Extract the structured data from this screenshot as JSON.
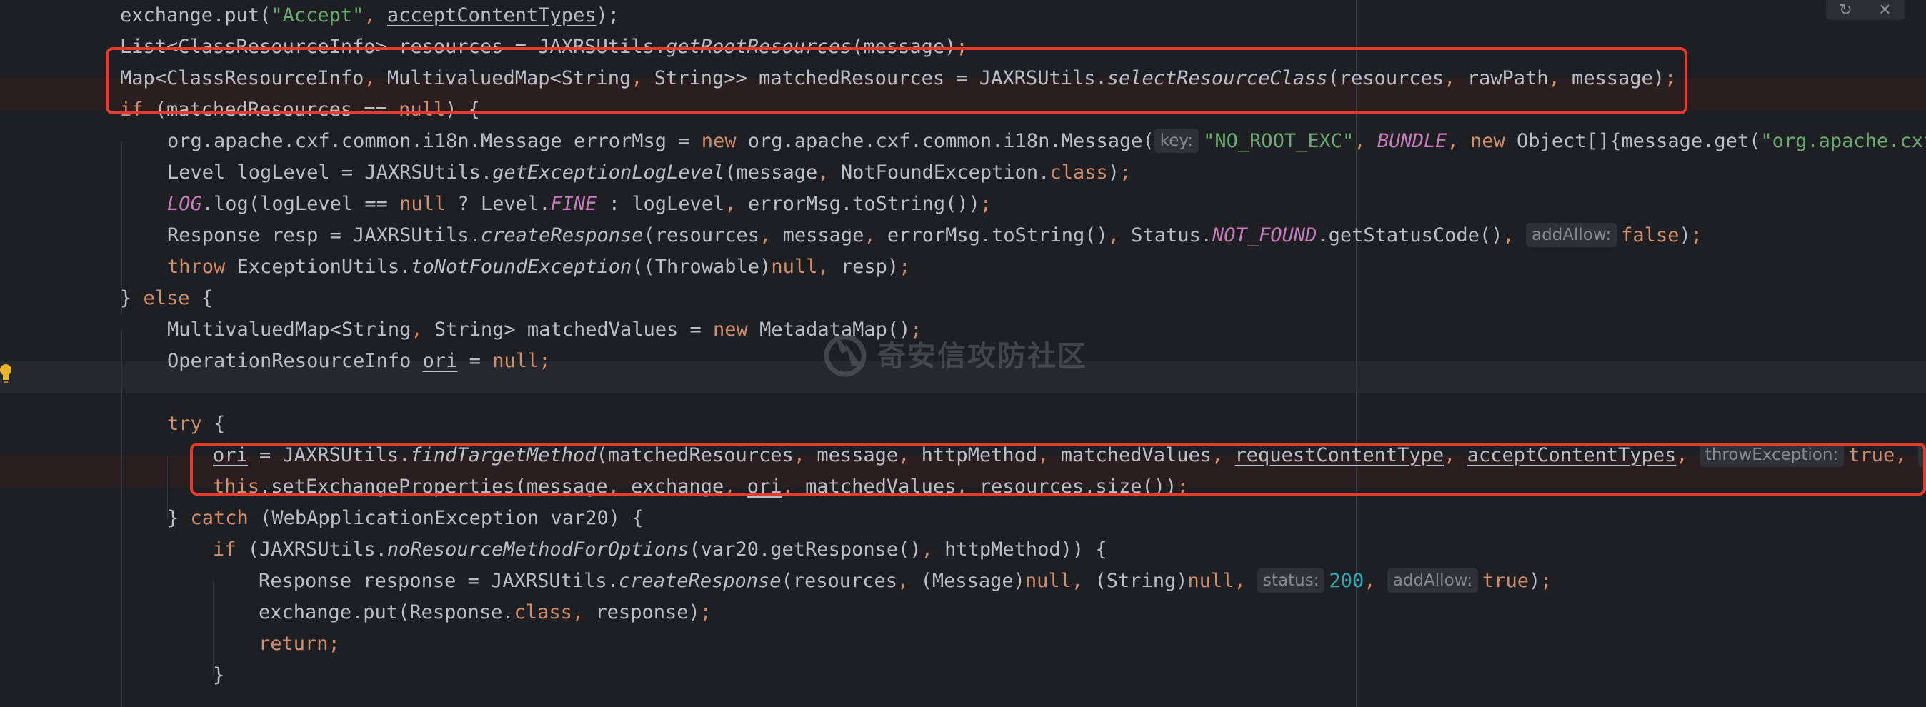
{
  "editor": {
    "watermark": "奇安信攻防社区",
    "toolbar": {
      "sync_icon": "↻",
      "close_icon": "✕"
    },
    "lines": [
      {
        "parts": [
          {
            "t": "exchange.put(",
            "c": ""
          },
          {
            "t": "\"Accept\"",
            "c": "tok-str"
          },
          {
            "t": ", ",
            "c": "tok-punc"
          },
          {
            "t": "acceptContentTypes",
            "c": "tok-ul"
          },
          {
            "t": ");",
            "c": ""
          }
        ]
      },
      {
        "parts": [
          {
            "t": "List<ClassResourceInfo> resources = JAXRSUtils.",
            "c": ""
          },
          {
            "t": "getRootResources",
            "c": "tok-it"
          },
          {
            "t": "(message)",
            "c": ""
          },
          {
            "t": ";",
            "c": "tok-punc"
          }
        ]
      },
      {
        "parts": [
          {
            "t": "Map<ClassResourceInfo",
            "c": ""
          },
          {
            "t": ", ",
            "c": "tok-punc"
          },
          {
            "t": "MultivaluedMap<String",
            "c": ""
          },
          {
            "t": ", ",
            "c": "tok-punc"
          },
          {
            "t": "String>> matchedResources = JAXRSUtils.",
            "c": ""
          },
          {
            "t": "selectResourceClass",
            "c": "tok-it"
          },
          {
            "t": "(resources",
            "c": ""
          },
          {
            "t": ", ",
            "c": "tok-punc"
          },
          {
            "t": "rawPath",
            "c": ""
          },
          {
            "t": ", ",
            "c": "tok-punc"
          },
          {
            "t": "message)",
            "c": ""
          },
          {
            "t": ";",
            "c": "tok-punc"
          }
        ]
      },
      {
        "parts": [
          {
            "t": "if ",
            "c": "tok-kw"
          },
          {
            "t": "(matchedResources == ",
            "c": ""
          },
          {
            "t": "null",
            "c": "tok-kw"
          },
          {
            "t": ") {",
            "c": ""
          }
        ]
      },
      {
        "parts": [
          {
            "t": "org.apache.cxf.common.i18n.Message errorMsg = ",
            "c": ""
          },
          {
            "t": "new ",
            "c": "tok-kw"
          },
          {
            "t": "org.apache.cxf.common.i18n.Message(",
            "c": ""
          },
          {
            "t": "key:",
            "c": "hint"
          },
          {
            "t": "\"NO_ROOT_EXC\"",
            "c": "tok-str"
          },
          {
            "t": ", ",
            "c": "tok-punc"
          },
          {
            "t": "BUNDLE",
            "c": "tok-static"
          },
          {
            "t": ", ",
            "c": "tok-punc"
          },
          {
            "t": "new ",
            "c": "tok-kw"
          },
          {
            "t": "Object[]{message.get(",
            "c": ""
          },
          {
            "t": "\"org.apache.cxf.",
            "c": "tok-str"
          }
        ]
      },
      {
        "parts": [
          {
            "t": "Level logLevel = JAXRSUtils.",
            "c": ""
          },
          {
            "t": "getExceptionLogLevel",
            "c": "tok-it"
          },
          {
            "t": "(message",
            "c": ""
          },
          {
            "t": ", ",
            "c": "tok-punc"
          },
          {
            "t": "NotFoundException.",
            "c": ""
          },
          {
            "t": "class",
            "c": "tok-kw"
          },
          {
            "t": ")",
            "c": ""
          },
          {
            "t": ";",
            "c": "tok-punc"
          }
        ]
      },
      {
        "parts": [
          {
            "t": "LOG",
            "c": "tok-static"
          },
          {
            "t": ".log(logLevel == ",
            "c": ""
          },
          {
            "t": "null ",
            "c": "tok-kw"
          },
          {
            "t": "? Level.",
            "c": ""
          },
          {
            "t": "FINE ",
            "c": "tok-static"
          },
          {
            "t": ": logLevel",
            "c": ""
          },
          {
            "t": ", ",
            "c": "tok-punc"
          },
          {
            "t": "errorMsg.toString())",
            "c": ""
          },
          {
            "t": ";",
            "c": "tok-punc"
          }
        ]
      },
      {
        "parts": [
          {
            "t": "Response resp = JAXRSUtils.",
            "c": ""
          },
          {
            "t": "createResponse",
            "c": "tok-it"
          },
          {
            "t": "(resources",
            "c": ""
          },
          {
            "t": ", ",
            "c": "tok-punc"
          },
          {
            "t": "message",
            "c": ""
          },
          {
            "t": ", ",
            "c": "tok-punc"
          },
          {
            "t": "errorMsg.toString()",
            "c": ""
          },
          {
            "t": ", ",
            "c": "tok-punc"
          },
          {
            "t": "Status.",
            "c": ""
          },
          {
            "t": "NOT_FOUND",
            "c": "tok-static"
          },
          {
            "t": ".getStatusCode()",
            "c": ""
          },
          {
            "t": ", ",
            "c": "tok-punc"
          },
          {
            "t": "addAllow:",
            "c": "hint"
          },
          {
            "t": "false",
            "c": "tok-kw"
          },
          {
            "t": ")",
            "c": ""
          },
          {
            "t": ";",
            "c": "tok-punc"
          }
        ]
      },
      {
        "parts": [
          {
            "t": "throw ",
            "c": "tok-kw"
          },
          {
            "t": "ExceptionUtils.",
            "c": ""
          },
          {
            "t": "toNotFoundException",
            "c": "tok-it"
          },
          {
            "t": "((Throwable)",
            "c": ""
          },
          {
            "t": "null",
            "c": "tok-kw"
          },
          {
            "t": ", ",
            "c": "tok-punc"
          },
          {
            "t": "resp)",
            "c": ""
          },
          {
            "t": ";",
            "c": "tok-punc"
          }
        ]
      },
      {
        "parts": [
          {
            "t": "} ",
            "c": ""
          },
          {
            "t": "else ",
            "c": "tok-kw"
          },
          {
            "t": "{",
            "c": ""
          }
        ]
      },
      {
        "parts": [
          {
            "t": "MultivaluedMap<String",
            "c": ""
          },
          {
            "t": ", ",
            "c": "tok-punc"
          },
          {
            "t": "String> matchedValues = ",
            "c": ""
          },
          {
            "t": "new ",
            "c": "tok-kw"
          },
          {
            "t": "MetadataMap()",
            "c": ""
          },
          {
            "t": ";",
            "c": "tok-punc"
          }
        ]
      },
      {
        "parts": [
          {
            "t": "OperationResourceInfo ",
            "c": ""
          },
          {
            "t": "ori",
            "c": "tok-ul"
          },
          {
            "t": " = ",
            "c": ""
          },
          {
            "t": "null",
            "c": "tok-kw"
          },
          {
            "t": ";",
            "c": "tok-punc"
          }
        ]
      },
      {
        "parts": []
      },
      {
        "parts": [
          {
            "t": "try ",
            "c": "tok-kw"
          },
          {
            "t": "{",
            "c": ""
          }
        ]
      },
      {
        "parts": [
          {
            "t": "ori",
            "c": "tok-ul"
          },
          {
            "t": " = JAXRSUtils.",
            "c": ""
          },
          {
            "t": "findTargetMethod",
            "c": "tok-it"
          },
          {
            "t": "(matchedResources",
            "c": ""
          },
          {
            "t": ", ",
            "c": "tok-punc"
          },
          {
            "t": "message",
            "c": ""
          },
          {
            "t": ", ",
            "c": "tok-punc"
          },
          {
            "t": "httpMethod",
            "c": ""
          },
          {
            "t": ", ",
            "c": "tok-punc"
          },
          {
            "t": "matchedValues",
            "c": ""
          },
          {
            "t": ", ",
            "c": "tok-punc"
          },
          {
            "t": "requestContentType",
            "c": "tok-ul"
          },
          {
            "t": ", ",
            "c": "tok-punc"
          },
          {
            "t": "acceptContentTypes",
            "c": "tok-ul"
          },
          {
            "t": ", ",
            "c": "tok-punc"
          },
          {
            "t": "throwException:",
            "c": "hint"
          },
          {
            "t": "true",
            "c": "tok-kw"
          },
          {
            "t": ", ",
            "c": "tok-punc"
          },
          {
            "t": "r",
            "c": "hint"
          }
        ]
      },
      {
        "parts": [
          {
            "t": "this",
            "c": "tok-kw"
          },
          {
            "t": ".setExchangeProperties(message",
            "c": ""
          },
          {
            "t": ", ",
            "c": "tok-punc"
          },
          {
            "t": "exchange",
            "c": ""
          },
          {
            "t": ", ",
            "c": "tok-punc"
          },
          {
            "t": "ori",
            "c": "tok-ul"
          },
          {
            "t": ", ",
            "c": "tok-punc"
          },
          {
            "t": "matchedValues",
            "c": ""
          },
          {
            "t": ", ",
            "c": "tok-punc"
          },
          {
            "t": "resources.size())",
            "c": ""
          },
          {
            "t": ";",
            "c": "tok-punc"
          }
        ]
      },
      {
        "parts": [
          {
            "t": "} ",
            "c": ""
          },
          {
            "t": "catch ",
            "c": "tok-kw"
          },
          {
            "t": "(WebApplicationException var20) {",
            "c": ""
          }
        ]
      },
      {
        "parts": [
          {
            "t": "if ",
            "c": "tok-kw"
          },
          {
            "t": "(JAXRSUtils.",
            "c": ""
          },
          {
            "t": "noResourceMethodForOptions",
            "c": "tok-it"
          },
          {
            "t": "(var20.getResponse()",
            "c": ""
          },
          {
            "t": ", ",
            "c": "tok-punc"
          },
          {
            "t": "httpMethod)) {",
            "c": ""
          }
        ]
      },
      {
        "parts": [
          {
            "t": "Response response = JAXRSUtils.",
            "c": ""
          },
          {
            "t": "createResponse",
            "c": "tok-it"
          },
          {
            "t": "(resources",
            "c": ""
          },
          {
            "t": ", ",
            "c": "tok-punc"
          },
          {
            "t": "(Message)",
            "c": ""
          },
          {
            "t": "null",
            "c": "tok-kw"
          },
          {
            "t": ", ",
            "c": "tok-punc"
          },
          {
            "t": "(String)",
            "c": ""
          },
          {
            "t": "null",
            "c": "tok-kw"
          },
          {
            "t": ", ",
            "c": "tok-punc"
          },
          {
            "t": "status:",
            "c": "hint"
          },
          {
            "t": "200",
            "c": "tok-num"
          },
          {
            "t": ", ",
            "c": "tok-punc"
          },
          {
            "t": "addAllow:",
            "c": "hint"
          },
          {
            "t": "true",
            "c": "tok-kw"
          },
          {
            "t": ")",
            "c": ""
          },
          {
            "t": ";",
            "c": "tok-punc"
          }
        ]
      },
      {
        "parts": [
          {
            "t": "exchange.put(Response.",
            "c": ""
          },
          {
            "t": "class",
            "c": "tok-kw"
          },
          {
            "t": ", ",
            "c": "tok-punc"
          },
          {
            "t": "response)",
            "c": ""
          },
          {
            "t": ";",
            "c": "tok-punc"
          }
        ]
      },
      {
        "parts": [
          {
            "t": "return",
            "c": "tok-kw"
          },
          {
            "t": ";",
            "c": "tok-punc"
          }
        ]
      },
      {
        "parts": [
          {
            "t": "}",
            "c": ""
          }
        ]
      }
    ]
  }
}
